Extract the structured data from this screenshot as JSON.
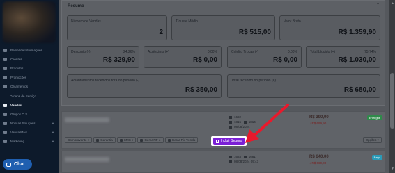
{
  "sidebar": {
    "items": [
      {
        "label": "Painel de Informações",
        "type": "item"
      },
      {
        "label": "Clientes",
        "type": "item"
      },
      {
        "label": "Produtos",
        "type": "item"
      },
      {
        "label": "Promoções",
        "type": "item"
      },
      {
        "label": "Orçamentos",
        "type": "item"
      },
      {
        "label": "Ordens de Serviço",
        "type": "sub"
      },
      {
        "label": "Vendas",
        "type": "active"
      },
      {
        "label": "Grupos O.S.",
        "type": "item"
      },
      {
        "label": "Nossas Soluções",
        "type": "chev"
      },
      {
        "label": "Venda Mais",
        "type": "chev"
      },
      {
        "label": "Marketing",
        "type": "chev"
      }
    ],
    "chat_label": "Chat"
  },
  "resumo": {
    "title": "Resumo",
    "row1": [
      {
        "label": "Número de Vendas",
        "value": "2"
      },
      {
        "label": "Tíquete Médio",
        "value": "R$ 515,00"
      },
      {
        "label": "Valor Bruto",
        "value": "R$ 1.359,90"
      }
    ],
    "row2": [
      {
        "label": "Desconto (-)",
        "pct": "24,26%",
        "value": "R$ 329,90"
      },
      {
        "label": "Acréscimo (+)",
        "pct": "0,00%",
        "value": "R$ 0,00"
      },
      {
        "label": "Crédito Trocas (-)",
        "pct": "0,00%",
        "value": "R$ 0,00"
      },
      {
        "label": "Total Líquido (=)",
        "pct": "75,74%",
        "value": "R$ 1.030,00"
      }
    ],
    "row3": [
      {
        "label": "Adiantamentos recebidos fora do período (-)",
        "value": "R$ 350,00"
      },
      {
        "label": "Total recebido no período (=)",
        "value": "R$ 680,00"
      }
    ]
  },
  "orders": [
    {
      "number": "1682",
      "line2a": "1815",
      "line2b": "1814",
      "date": "08/08/2024",
      "price": "R$ 390,00",
      "price_small": "↓ R$ 699,90",
      "badge": "Entregue",
      "badge_color": "#2f8a4a"
    },
    {
      "number": "1683",
      "line2a": "1681",
      "date": "08/08/2024 09:43",
      "price": "R$ 640,00",
      "price_small": "↓ R$ 660,00",
      "badge": "Pago",
      "badge_color": "#2a9bb8"
    }
  ],
  "order_buttons": [
    {
      "label": "Comprovante",
      "caret": true
    },
    {
      "label": "Garantia",
      "caret": false
    },
    {
      "label": "SMS",
      "caret": true
    },
    {
      "label": "Gerar NF-e",
      "caret": false
    },
    {
      "label": "Gerar Pix Venda",
      "caret": false
    }
  ],
  "incluir_seguro_label": "Incluir Seguro",
  "opcoes_label": "Opções",
  "colors": {
    "highlight": "#7b20d6",
    "arrow": "#e8192c",
    "sidebar_bg": "#0d1a2b"
  }
}
